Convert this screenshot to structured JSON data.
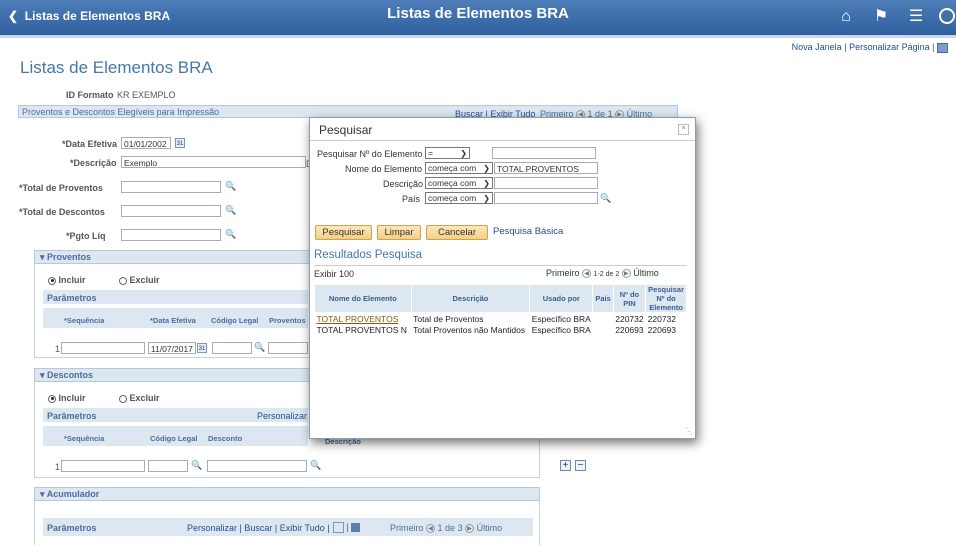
{
  "header": {
    "back_label": "Listas de Elementos BRA",
    "title": "Listas de Elementos BRA",
    "icons": [
      "home-icon",
      "flag-icon",
      "menu-icon",
      "navbar-icon"
    ]
  },
  "toplinks": {
    "new_window": "Nova Janela",
    "personalize": "Personalizar Página"
  },
  "page": {
    "heading": "Listas de Elementos BRA",
    "format_label": "ID Formato",
    "format_value": "KR EXEMPLO",
    "section_title": "Proventos e Descontos Elegíveis para Impressão",
    "section_links": "Buscar | Exibir Tudo",
    "nav": {
      "first": "Primeiro",
      "range": "1 de 1",
      "last": "Último"
    },
    "effective_date_label": "*Data Efetiva",
    "effective_date": "01/01/2002",
    "description_label": "*Descrição",
    "description": "Exemplo",
    "description_extra": "D",
    "total_earnings_label": "*Total de Proventos",
    "total_deductions_label": "*Total de Descontos",
    "net_pay_label": "*Pgto Líq"
  },
  "earnings": {
    "title": "Proventos",
    "include": "Incluir",
    "exclude": "Excluir",
    "params_title": "Parâmetros",
    "cols": [
      "*Sequência",
      "*Data Efetiva",
      "Código Legal",
      "Proventos"
    ],
    "row_seq": "1",
    "row_date": "11/07/2017"
  },
  "deductions": {
    "title": "Descontos",
    "include": "Incluir",
    "exclude": "Excluir",
    "params_title": "Parâmetros",
    "personalize": "Personalizar |",
    "cols": [
      "*Sequência",
      "Código Legal",
      "Desconto",
      "Descrição"
    ],
    "row_seq": "1"
  },
  "accumulator": {
    "title": "Acumulador",
    "params_title": "Parâmetros",
    "links": "Personalizar | Buscar | Exibir Tudo |",
    "nav": {
      "first": "Primeiro",
      "range": "1 de 3",
      "last": "Último"
    }
  },
  "modal": {
    "title": "Pesquisar",
    "close": "×",
    "f1_label": "Pesquisar Nº do Elemento",
    "f1_op": "=",
    "f2_label": "Nome do Elemento",
    "f2_op": "começa com",
    "f2_value": "TOTAL PROVENTOS",
    "f3_label": "Descrição",
    "f3_op": "começa com",
    "f4_label": "País",
    "f4_op": "começa com",
    "btn_search": "Pesquisar",
    "btn_clear": "Limpar",
    "btn_cancel": "Cancelar",
    "basic_link": "Pesquisa Básica",
    "results_title": "Resultados Pesquisa",
    "show_label": "Exibir 100",
    "nav": {
      "first": "Primeiro",
      "range": "1-2 de 2",
      "last": "Último"
    },
    "columns": [
      "Nome do Elemento",
      "Descrição",
      "Usado por",
      "País",
      "Nº do PIN",
      "Pesquisar Nº do Elemento"
    ],
    "rows": [
      {
        "name": "TOTAL PROVENTOS",
        "desc": "Total de Proventos",
        "used_by": "Específico BRA",
        "country": "",
        "pin": "220732",
        "elem": "220732"
      },
      {
        "name": "TOTAL PROVENTOS N",
        "desc": "Total Proventos não Mantidos",
        "used_by": "Específico BRA",
        "country": "",
        "pin": "220693",
        "elem": "220693"
      }
    ]
  }
}
